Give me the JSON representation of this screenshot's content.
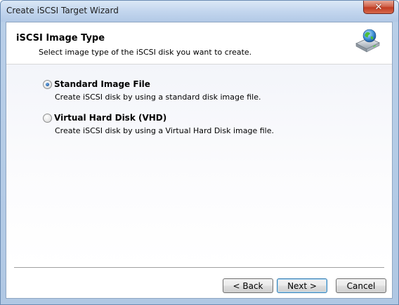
{
  "window": {
    "title": "Create iSCSI Target Wizard",
    "close_glyph": "✕"
  },
  "header": {
    "title": "iSCSI Image Type",
    "subtitle": "Select image type of the iSCSI disk you want to create.",
    "icon": "disk-globe-icon"
  },
  "options": [
    {
      "label": "Standard Image File",
      "description": "Create iSCSI disk by using a standard disk image file.",
      "checked": true
    },
    {
      "label": "Virtual Hard Disk (VHD)",
      "description": "Create iSCSI disk by using a Virtual Hard Disk image file.",
      "checked": false
    }
  ],
  "buttons": {
    "back": "< Back",
    "next": "Next >",
    "cancel": "Cancel"
  },
  "colors": {
    "titlebar": "#c3d6ee",
    "close_button": "#c23c22",
    "radio_selected": "#1f5ea8"
  }
}
